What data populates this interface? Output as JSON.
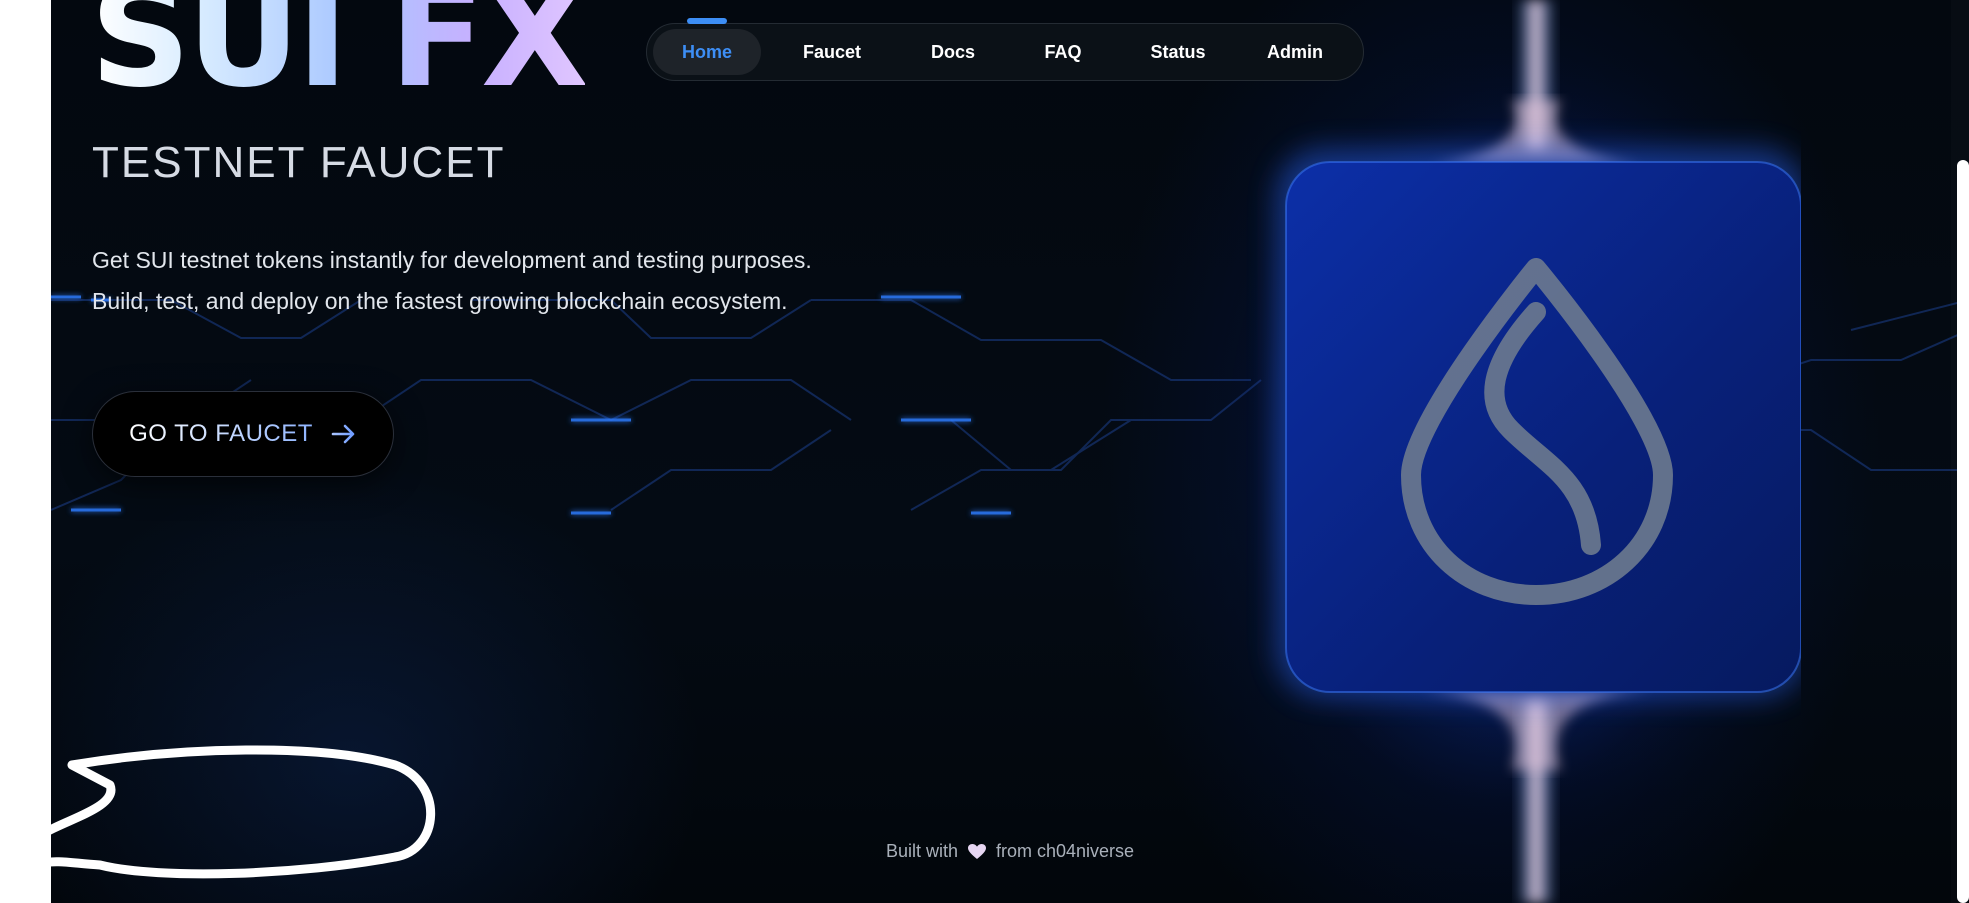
{
  "hero": {
    "title": "SUI FX",
    "subtitle": "TESTNET FAUCET",
    "description_line1": "Get SUI testnet tokens instantly for development and testing purposes.",
    "description_line2": "Build, test, and deploy on the fastest growing blockchain ecosystem.",
    "cta_label": "GO TO FAUCET",
    "cta_icon": "arrow-right-icon"
  },
  "nav": {
    "items": [
      {
        "label": "Home",
        "active": true
      },
      {
        "label": "Faucet",
        "active": false
      },
      {
        "label": "Docs",
        "active": false
      },
      {
        "label": "FAQ",
        "active": false
      },
      {
        "label": "Status",
        "active": false
      },
      {
        "label": "Admin",
        "active": false
      }
    ]
  },
  "footer": {
    "prefix": "Built with",
    "icon": "heart-icon",
    "suffix": "from ch04niverse"
  },
  "colors": {
    "background": "#03080f",
    "accent": "#3d8ef5",
    "glow": "#1a4bff",
    "nav_bg": "#0b1117",
    "logo_tile": "#0a2a8f",
    "logo_drop": "#6a7688"
  }
}
